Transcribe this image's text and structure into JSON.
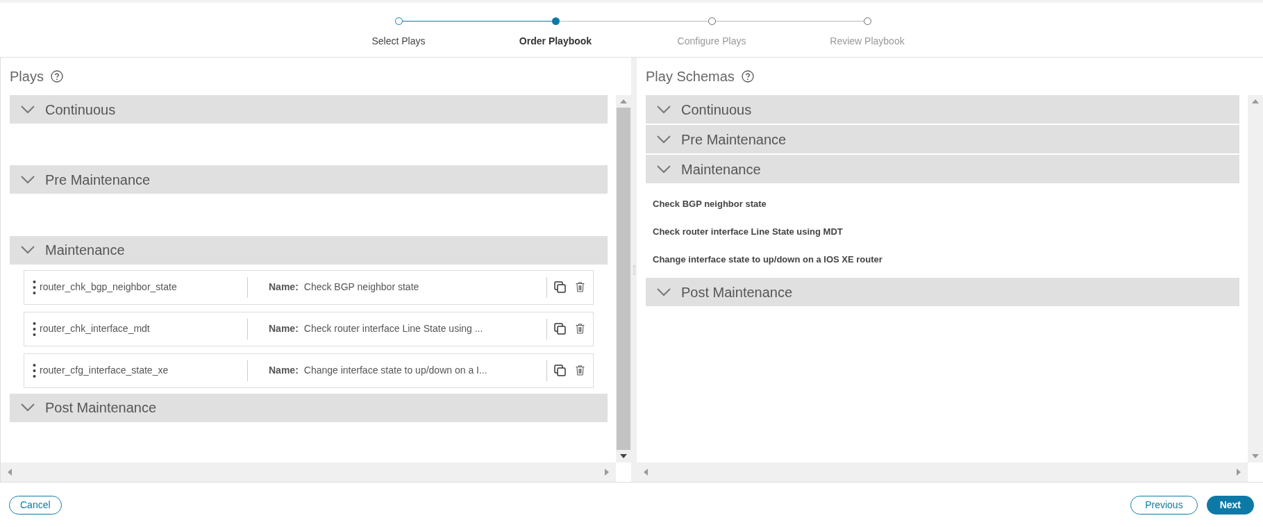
{
  "steps": [
    {
      "label": "Select Plays",
      "completed": true,
      "selected": false
    },
    {
      "label": "Order Playbook",
      "completed": false,
      "selected": true
    },
    {
      "label": "Configure Plays",
      "completed": false,
      "selected": false
    },
    {
      "label": "Review Playbook",
      "completed": false,
      "selected": false
    }
  ],
  "plays_panel": {
    "title": "Plays",
    "sections": [
      {
        "title": "Continuous"
      },
      {
        "title": "Pre Maintenance"
      },
      {
        "title": "Maintenance",
        "plays": [
          {
            "id": "router_chk_bgp_neighbor_state",
            "name_label": "Name:",
            "name": "Check BGP neighbor state"
          },
          {
            "id": "router_chk_interface_mdt",
            "name_label": "Name:",
            "name": "Check router interface Line State using ..."
          },
          {
            "id": "router_cfg_interface_state_xe",
            "name_label": "Name:",
            "name": "Change interface state to up/down on a I..."
          }
        ]
      },
      {
        "title": "Post Maintenance"
      }
    ]
  },
  "schemas_panel": {
    "title": "Play Schemas",
    "sections": [
      {
        "title": "Continuous"
      },
      {
        "title": "Pre Maintenance"
      },
      {
        "title": "Maintenance",
        "items": [
          "Check BGP neighbor state",
          "Check router interface Line State using MDT",
          "Change interface state to up/down on a IOS XE router"
        ]
      },
      {
        "title": "Post Maintenance"
      }
    ]
  },
  "footer": {
    "cancel": "Cancel",
    "previous": "Previous",
    "next": "Next"
  }
}
